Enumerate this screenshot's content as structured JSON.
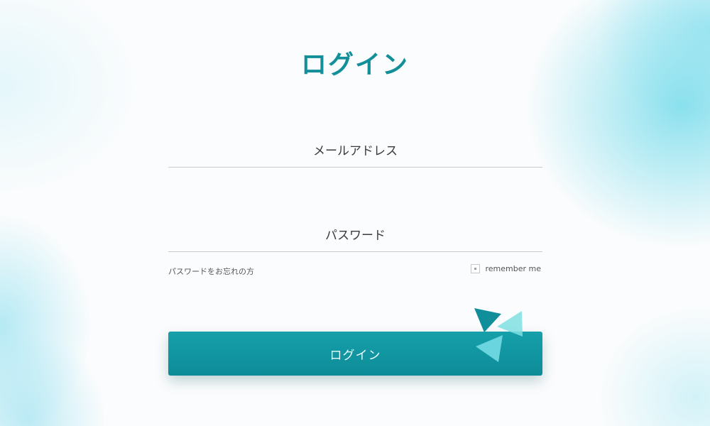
{
  "page": {
    "title": "ログイン"
  },
  "form": {
    "email_placeholder": "メールアドレス",
    "password_placeholder": "パスワード",
    "forgot_password_label": "パスワードをお忘れの方",
    "remember_me_label": "remember me",
    "submit_label": "ログイン"
  },
  "colors": {
    "accent": "#138f9a",
    "button": "#0f929d",
    "decoration_light": "#7fdfe0"
  },
  "icons": {
    "decoration": "paper-triangles-decoration"
  }
}
